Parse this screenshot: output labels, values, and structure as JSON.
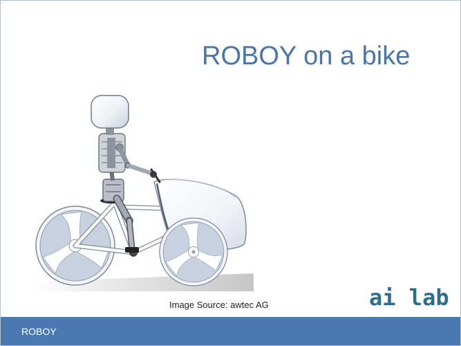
{
  "slide": {
    "title": "ROBOY on a bike",
    "image_caption": "Image Source: awtec AG",
    "logo_text": "ai lab",
    "footer_text": "ROBOY"
  },
  "colors": {
    "title": "#4a74aa",
    "logo": "#2d6d8d",
    "footer_bg": "#4a78b0",
    "footer_text": "#ffffff",
    "border": "#b4c0d0"
  }
}
